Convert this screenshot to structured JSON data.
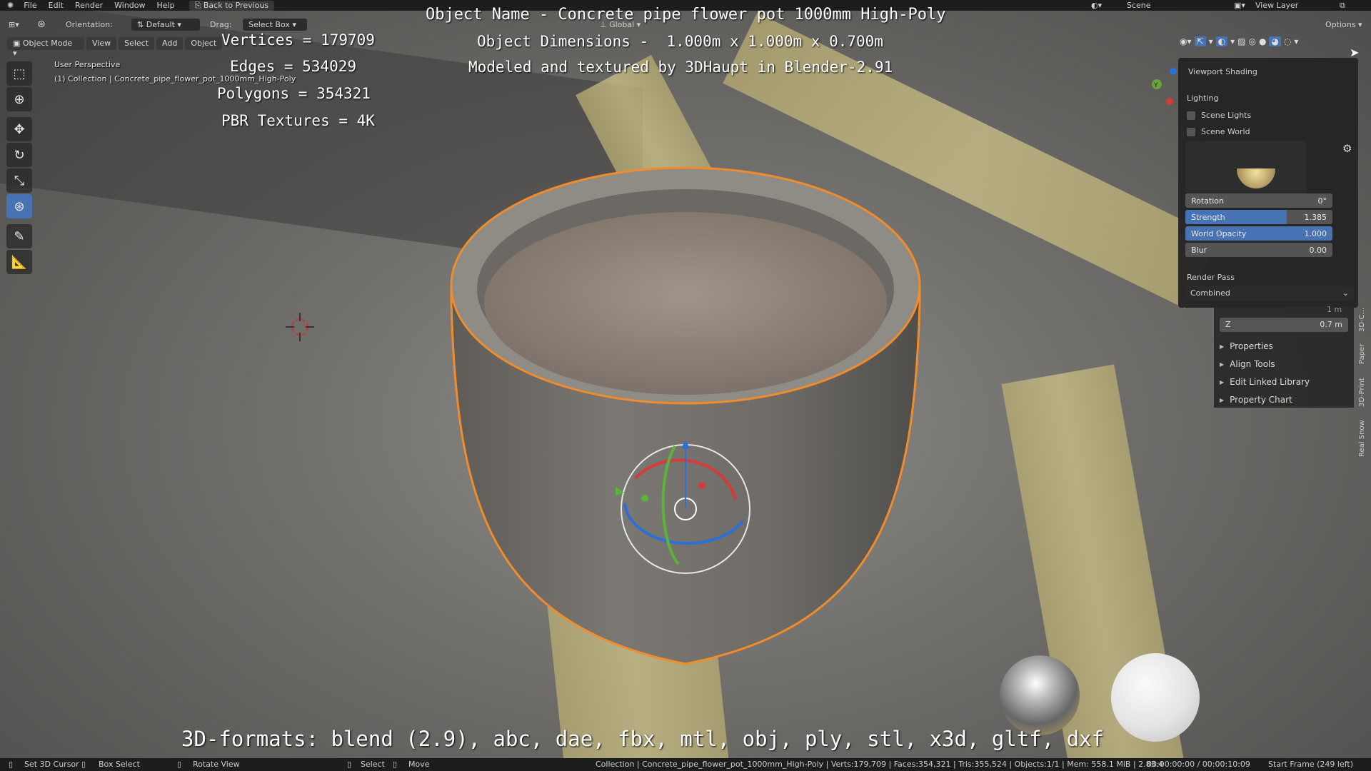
{
  "topbar": {
    "menus": [
      "File",
      "Edit",
      "Render",
      "Window",
      "Help"
    ],
    "back_label": "Back to Previous",
    "scene_label": "Scene",
    "view_layer_label": "View Layer"
  },
  "header": {
    "orientation_label": "Orientation:",
    "orientation_value": "Default",
    "drag_label": "Drag:",
    "drag_value": "Select Box",
    "transform_space": "Global",
    "options_label": "Options",
    "mode": "Object Mode",
    "view": "View",
    "select": "Select",
    "add": "Add",
    "object": "Object"
  },
  "overlay": {
    "stats": [
      "Vertices = 179709",
      "Edges = 534029",
      "Polygons = 354321",
      "PBR Textures = 4K"
    ],
    "title": "Object Name - Concrete pipe flower pot 1000mm High-Poly",
    "dimensions": "Object Dimensions -  1.000m x 1.000m x 0.700m",
    "credit": "Modeled and textured by 3DHaupt in Blender-2.91",
    "formats": "3D-formats: blend (2.9), abc, dae, fbx, mtl, obj, ply, stl, x3d, gltf, dxf",
    "perspective": "User Perspective",
    "collection": "(1) Collection | Concrete_pipe_flower_pot_1000mm_High-Poly"
  },
  "shading": {
    "title": "Viewport Shading",
    "lighting": "Lighting",
    "scene_lights": "Scene Lights",
    "scene_world": "Scene World",
    "rotation_label": "Rotation",
    "rotation_value": "0°",
    "strength_label": "Strength",
    "strength_value": "1.385",
    "strength_fraction": 0.69,
    "opacity_label": "World Opacity",
    "opacity_value": "1.000",
    "opacity_fraction": 1.0,
    "blur_label": "Blur",
    "blur_value": "0.00",
    "render_pass_label": "Render Pass",
    "render_pass_value": "Combined"
  },
  "npanel": {
    "y_value": "1 m",
    "z_label": "Z",
    "z_value": "0.7 m",
    "sections": [
      "Properties",
      "Align Tools",
      "Edit Linked Library",
      "Property Chart"
    ],
    "tabs": [
      "3D-C...",
      "Paper",
      "3D-Print",
      "Real Snow"
    ]
  },
  "status": {
    "set_cursor": "Set 3D Cursor",
    "box_select": "Box Select",
    "rotate_view": "Rotate View",
    "select": "Select",
    "move": "Move",
    "info": "Collection | Concrete_pipe_flower_pot_1000mm_High-Poly | Verts:179,709 | Faces:354,321 | Tris:355,524 | Objects:1/1 | Mem: 558.1 MiB | 2.83.4",
    "time": "00:00:00:00 / 00:00:10:09",
    "frame": "Start Frame (249 left)"
  },
  "colors": {
    "accent": "#4772b3",
    "selection_outline": "#f08c2c",
    "bar": "#1d1d1d"
  }
}
